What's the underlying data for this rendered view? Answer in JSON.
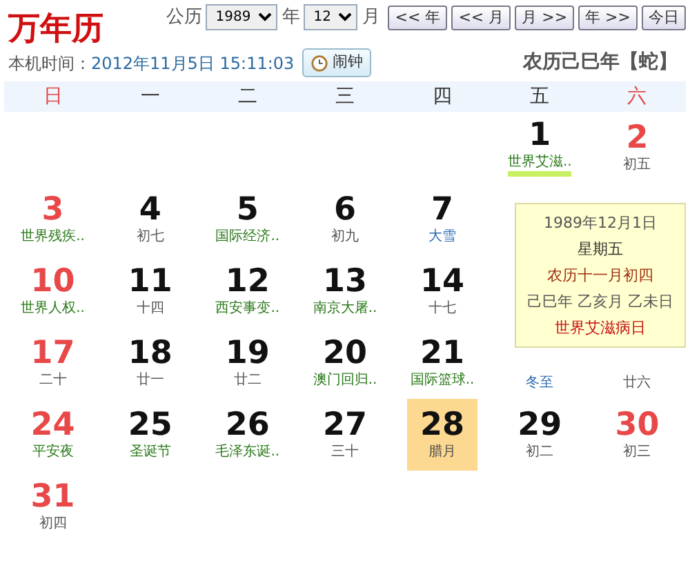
{
  "logo": "万年历",
  "controls": {
    "solar_label": "公历",
    "year": "1989",
    "year_unit": "年",
    "month": "12",
    "month_unit": "月",
    "buttons": [
      "<< 年",
      "<< 月",
      "月 >>",
      "年 >>",
      "今日"
    ]
  },
  "clock": {
    "label": "本机时间：",
    "time": "2012年11月5日 15:11:03",
    "alarm_button": "闹钟"
  },
  "lunar_year": "农历己巳年【蛇】",
  "weekdays": [
    {
      "label": "日",
      "weekend": true
    },
    {
      "label": "一",
      "weekend": false
    },
    {
      "label": "二",
      "weekend": false
    },
    {
      "label": "三",
      "weekend": false
    },
    {
      "label": "四",
      "weekend": false
    },
    {
      "label": "五",
      "weekend": false
    },
    {
      "label": "六",
      "weekend": true
    }
  ],
  "weeks": [
    [
      {
        "kind": "empty"
      },
      {
        "kind": "empty"
      },
      {
        "kind": "empty"
      },
      {
        "kind": "empty"
      },
      {
        "kind": "empty"
      },
      {
        "day": "1",
        "label": "世界艾滋..",
        "kind": "festival",
        "selected": false,
        "hovered": true
      },
      {
        "day": "2",
        "label": "初五",
        "kind": "lunar",
        "selected": false,
        "hovered": false
      }
    ],
    [
      {
        "day": "3",
        "label": "世界残疾..",
        "kind": "festival",
        "selected": false,
        "hovered": false
      },
      {
        "day": "4",
        "label": "初七",
        "kind": "lunar",
        "selected": false,
        "hovered": false
      },
      {
        "day": "5",
        "label": "国际经济..",
        "kind": "festival",
        "selected": false,
        "hovered": false
      },
      {
        "day": "6",
        "label": "初九",
        "kind": "lunar",
        "selected": false,
        "hovered": false
      },
      {
        "day": "7",
        "label": "大雪",
        "kind": "solar_term",
        "selected": false,
        "hovered": false
      }
    ],
    [
      {
        "day": "10",
        "label": "世界人权..",
        "kind": "festival",
        "selected": false,
        "hovered": false
      },
      {
        "day": "11",
        "label": "十四",
        "kind": "lunar",
        "selected": false,
        "hovered": false
      },
      {
        "day": "12",
        "label": "西安事变..",
        "kind": "festival",
        "selected": false,
        "hovered": false
      },
      {
        "day": "13",
        "label": "南京大屠..",
        "kind": "festival",
        "selected": false,
        "hovered": false
      },
      {
        "day": "14",
        "label": "十七",
        "kind": "lunar",
        "selected": false,
        "hovered": false
      }
    ],
    [
      {
        "day": "17",
        "label": "二十",
        "kind": "lunar",
        "selected": false,
        "hovered": false
      },
      {
        "day": "18",
        "label": "廿一",
        "kind": "lunar",
        "selected": false,
        "hovered": false
      },
      {
        "day": "19",
        "label": "廿二",
        "kind": "lunar",
        "selected": false,
        "hovered": false
      },
      {
        "day": "20",
        "label": "澳门回归..",
        "kind": "festival",
        "selected": false,
        "hovered": false
      },
      {
        "day": "21",
        "label": "国际篮球..",
        "kind": "festival",
        "selected": false,
        "hovered": false
      },
      {
        "label": "冬至",
        "kind": "solar_term",
        "selected": false,
        "hovered": false
      },
      {
        "label": "廿六",
        "kind": "lunar",
        "selected": false,
        "hovered": false
      }
    ],
    [
      {
        "day": "24",
        "label": "平安夜",
        "kind": "festival",
        "selected": false,
        "hovered": false
      },
      {
        "day": "25",
        "label": "圣诞节",
        "kind": "festival",
        "selected": false,
        "hovered": false
      },
      {
        "day": "26",
        "label": "毛泽东诞..",
        "kind": "festival",
        "selected": false,
        "hovered": false
      },
      {
        "day": "27",
        "label": "三十",
        "kind": "lunar",
        "selected": false,
        "hovered": false
      },
      {
        "day": "28",
        "label": "腊月",
        "kind": "lunar",
        "selected": true,
        "hovered": false
      },
      {
        "day": "29",
        "label": "初二",
        "kind": "lunar",
        "selected": false,
        "hovered": false
      },
      {
        "day": "30",
        "label": "初三",
        "kind": "lunar",
        "selected": false,
        "hovered": false
      }
    ],
    [
      {
        "day": "31",
        "label": "初四",
        "kind": "lunar",
        "selected": false,
        "hovered": false
      }
    ]
  ],
  "tooltip": {
    "date": "1989年12月1日",
    "weekday": "星期五",
    "lunar_date": "农历十一月初四",
    "ganzhi": "己巳年 乙亥月 乙未日",
    "festival": "世界艾滋病日"
  }
}
